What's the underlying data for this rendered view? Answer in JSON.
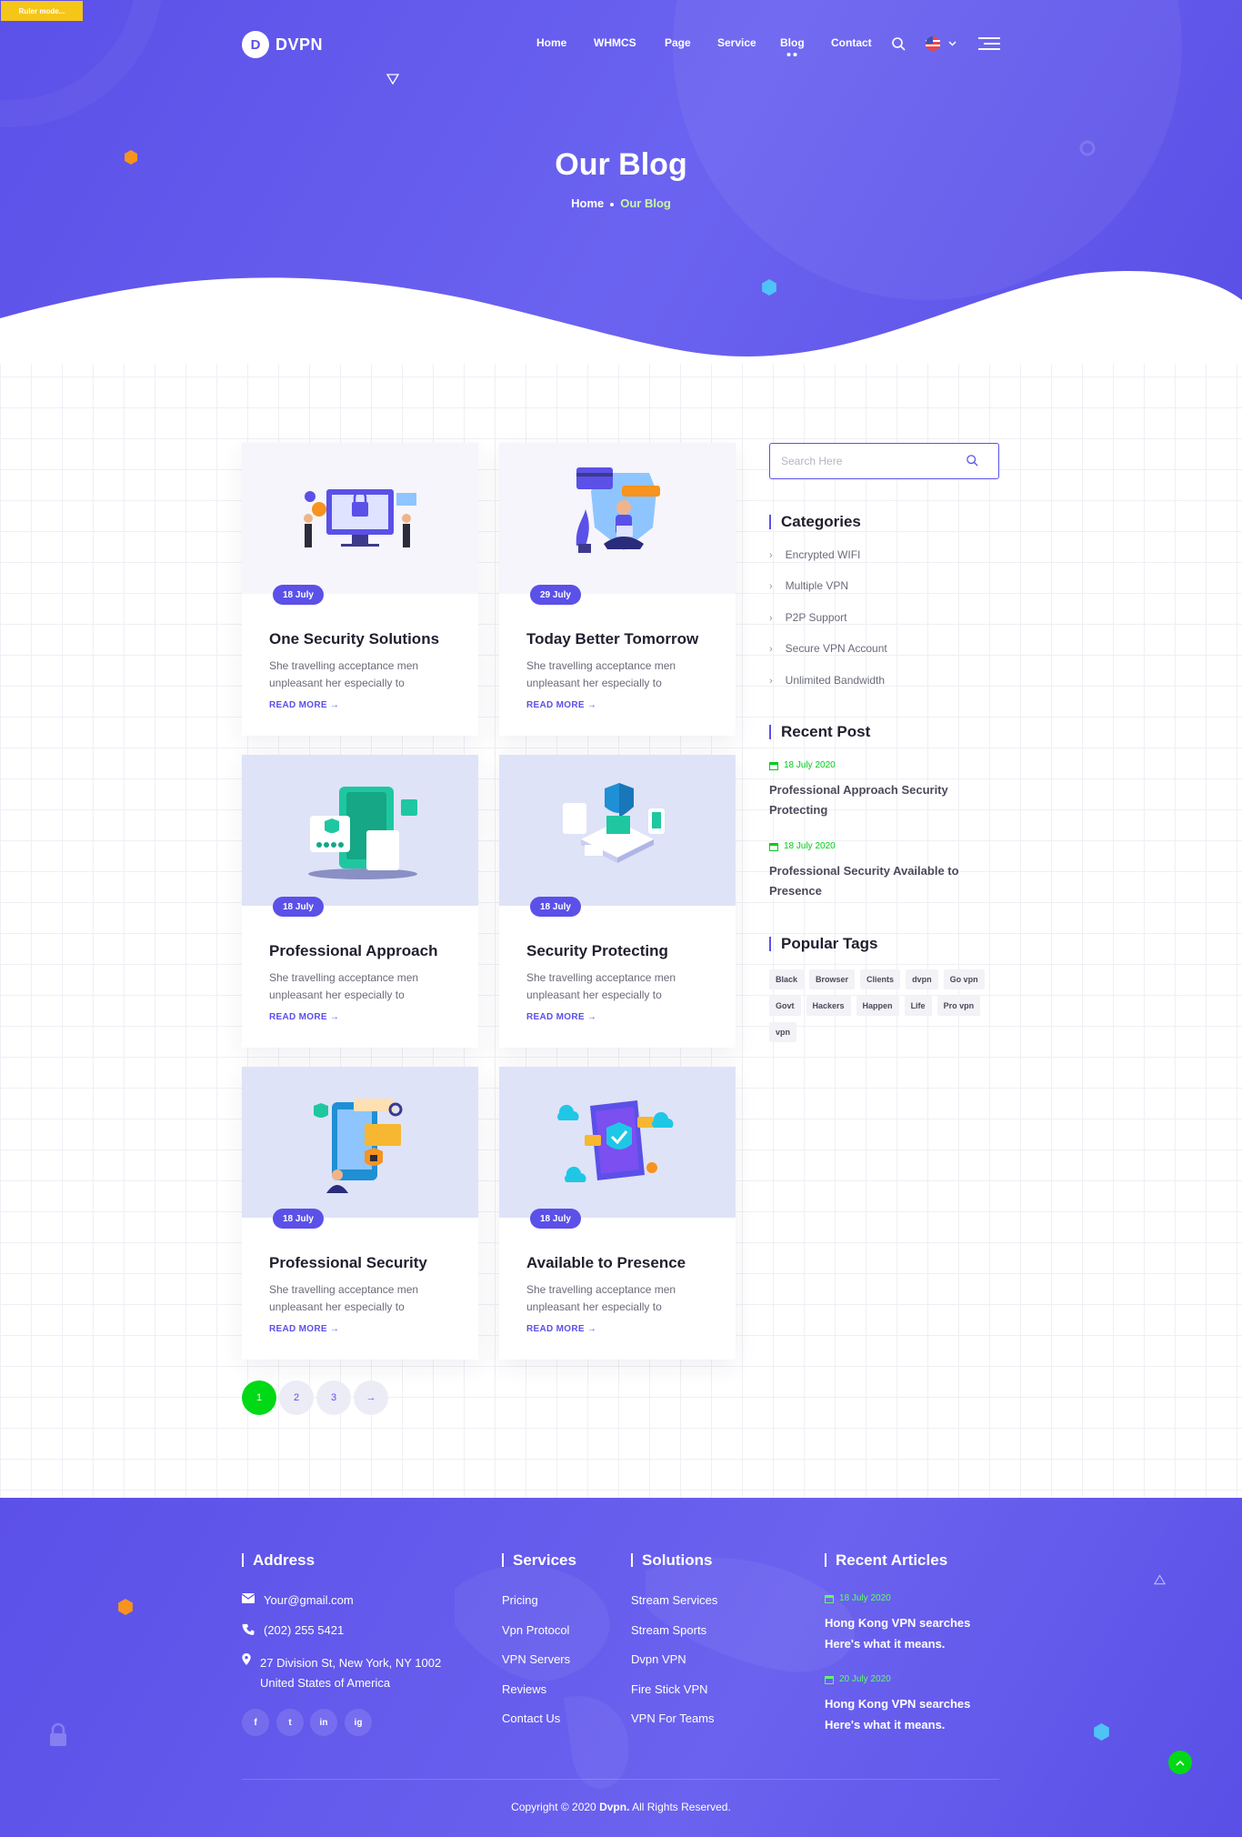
{
  "ruler_badge": "Ruler mode...",
  "brand": {
    "name": "DVPN",
    "mark": "D"
  },
  "nav": {
    "items": [
      "Home",
      "WHMCS",
      "Page",
      "Service",
      "Blog",
      "Contact"
    ],
    "active": "Blog"
  },
  "hero": {
    "title": "Our Blog",
    "breadcrumb": {
      "home": "Home",
      "current": "Our Blog"
    }
  },
  "posts": [
    {
      "date": "18 July",
      "title": "One Security Solutions",
      "excerpt": "She travelling acceptance men unpleasant her especially to",
      "more": "READ MORE"
    },
    {
      "date": "29 July",
      "title": "Today Better Tomorrow",
      "excerpt": "She travelling acceptance men unpleasant her especially to",
      "more": "READ MORE"
    },
    {
      "date": "18 July",
      "title": "Professional Approach",
      "excerpt": "She travelling acceptance men unpleasant her especially to",
      "more": "READ MORE"
    },
    {
      "date": "18 July",
      "title": "Security Protecting",
      "excerpt": "She travelling acceptance men unpleasant her especially to",
      "more": "READ MORE"
    },
    {
      "date": "18 July",
      "title": "Professional Security",
      "excerpt": "She travelling acceptance men unpleasant her especially to",
      "more": "READ MORE"
    },
    {
      "date": "18 July",
      "title": "Available to Presence",
      "excerpt": "She travelling acceptance men unpleasant her especially to",
      "more": "READ MORE"
    }
  ],
  "pagination": {
    "pages": [
      "1",
      "2",
      "3"
    ],
    "current": "1",
    "next": "→"
  },
  "sidebar": {
    "search_placeholder": "Search Here",
    "categories_title": "Categories",
    "categories": [
      "Encrypted WIFI",
      "Multiple VPN",
      "P2P Support",
      "Secure VPN Account",
      "Unlimited Bandwidth"
    ],
    "recent_title": "Recent Post",
    "recent": [
      {
        "date": "18 July 2020",
        "title": "Professional Approach Security Protecting"
      },
      {
        "date": "18 July 2020",
        "title": "Professional Security Available to Presence"
      }
    ],
    "tags_title": "Popular Tags",
    "tags": [
      "Black",
      "Browser",
      "Clients",
      "dvpn",
      "Go vpn",
      "Govt",
      "Hackers",
      "Happen",
      "Life",
      "Pro vpn",
      "vpn"
    ]
  },
  "footer": {
    "address_title": "Address",
    "email": "Your@gmail.com",
    "phone": "(202) 255 5421",
    "address_line1": "27 Division St, New York, NY 1002",
    "address_line2": "United States of America",
    "services_title": "Services",
    "services": [
      "Pricing",
      "Vpn Protocol",
      "VPN Servers",
      "Reviews",
      "Contact Us"
    ],
    "solutions_title": "Solutions",
    "solutions": [
      "Stream Services",
      "Stream Sports",
      "Dvpn VPN",
      "Fire Stick VPN",
      "VPN For Teams"
    ],
    "articles_title": "Recent Articles",
    "articles": [
      {
        "date": "18 July 2020",
        "title": "Hong Kong VPN searches Here's what it means."
      },
      {
        "date": "20 July 2020",
        "title": "Hong Kong VPN searches Here's what it means."
      }
    ],
    "social": [
      "f",
      "t",
      "in",
      "ig"
    ],
    "copyright_prefix": "Copyright © 2020",
    "copyright_brand": "Dvpn.",
    "copyright_suffix": "All Rights Reserved."
  },
  "colors": {
    "primary": "#5b50e8",
    "accent_green": "#00d916",
    "date_green": "#00cc16"
  }
}
